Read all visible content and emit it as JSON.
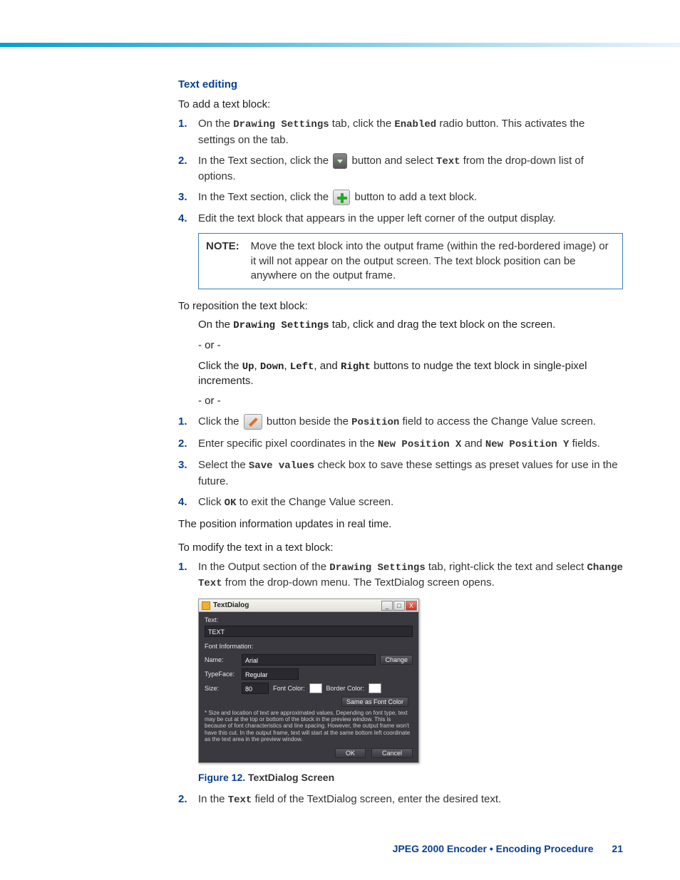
{
  "section": {
    "heading": "Text editing"
  },
  "intro_add": "To add a text block:",
  "steps_add": {
    "s1a": "On the ",
    "s1b": "Drawing Settings",
    "s1c": " tab, click the ",
    "s1d": "Enabled",
    "s1e": " radio button. This activates the settings on the tab.",
    "s2a": "In the Text section, click the ",
    "s2b": " button and select ",
    "s2c": "Text",
    "s2d": " from the drop-down list of options.",
    "s3a": "In the Text section, click the ",
    "s3b": " button to add a text block.",
    "s4": "Edit the text block that appears in the upper left corner of the output display."
  },
  "note": {
    "label": "NOTE:",
    "text": "Move the text block into the output frame (within the red-bordered image) or it will not appear on the output screen. The text block position can be anywhere on the output frame."
  },
  "intro_repos": "To reposition the text block:",
  "repos": {
    "l1a": "On the ",
    "l1b": "Drawing Settings",
    "l1c": " tab, click and drag the text block on the screen.",
    "or": "- or -",
    "l2a": "Click the ",
    "l2b": "Up",
    "l2c": ", ",
    "l2d": "Down",
    "l2e": ", ",
    "l2f": "Left",
    "l2g": ", and ",
    "l2h": "Right",
    "l2i": " buttons to nudge the text block in single-pixel increments."
  },
  "steps_repos": {
    "s1a": "Click the ",
    "s1b": " button beside the ",
    "s1c": "Position",
    "s1d": " field to access the Change Value screen.",
    "s2a": "Enter specific pixel coordinates in the ",
    "s2b": "New Position X",
    "s2c": " and ",
    "s2d": "New Position Y",
    "s2e": " fields.",
    "s3a": "Select the ",
    "s3b": "Save values",
    "s3c": " check box to save these settings as preset values for use in the future.",
    "s4a": "Click ",
    "s4b": "OK",
    "s4c": " to exit the Change Value screen."
  },
  "repos_outro": "The position information updates in real time.",
  "intro_modify": "To modify the text in a text block:",
  "steps_modify": {
    "s1a": "In the Output section of the ",
    "s1b": "Drawing Settings",
    "s1c": " tab, right-click the text and select ",
    "s1d": "Change Text",
    "s1e": " from the drop-down menu. The TextDialog screen opens.",
    "s2a": "In the ",
    "s2b": "Text",
    "s2c": " field of the TextDialog screen, enter the desired text."
  },
  "dialog": {
    "title": "TextDialog",
    "text_label": "Text:",
    "text_value": "TEXT",
    "font_info": "Font Information:",
    "name_label": "Name:",
    "name_value": "Arial",
    "change_btn": "Change",
    "typeface_label": "TypeFace:",
    "typeface_value": "Regular",
    "size_label": "Size:",
    "size_value": "80",
    "fontcolor_label": "Font Color:",
    "bordercolor_label": "Border Color:",
    "same_btn": "Same as Font Color",
    "note": "* Size and location of text are approximated values. Depending on font type, text may be cut at the top or bottom of the block in the preview window. This is because of font characteristics and line spacing. However, the output frame won't have this cut. In the output frame, text will start at the same bottom left coordinate as the text area in the preview window.",
    "ok": "OK",
    "cancel": "Cancel",
    "min": "_",
    "max": "□",
    "close": "X"
  },
  "figure": {
    "num": "Figure 12.",
    "title": "  TextDialog Screen"
  },
  "footer": {
    "text": "JPEG 2000 Encoder • Encoding Procedure",
    "page": "21"
  }
}
